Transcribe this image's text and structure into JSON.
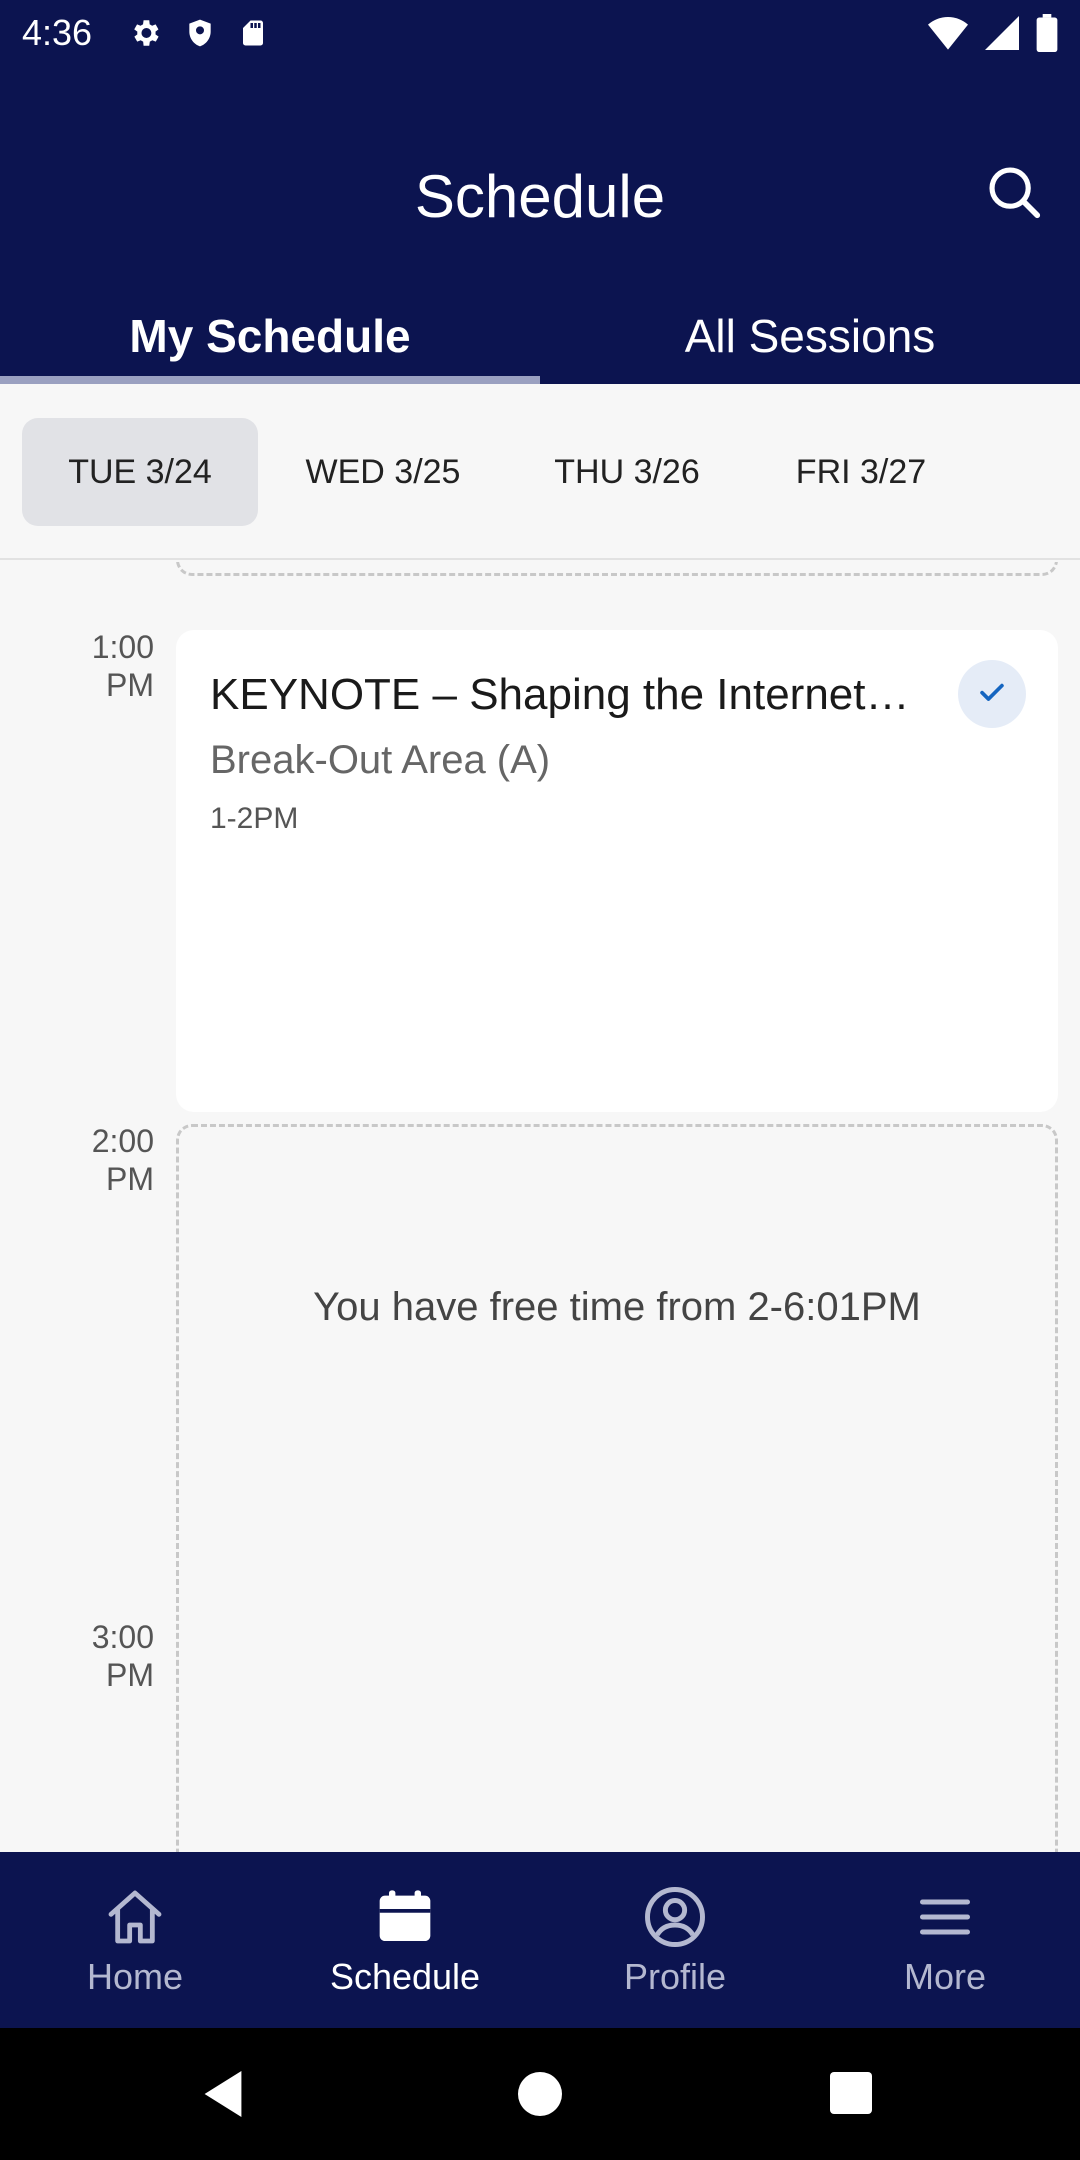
{
  "status_bar": {
    "time": "4:36",
    "icons_left": [
      "gear-icon",
      "shield-icon",
      "sd-card-icon"
    ],
    "icons_right": [
      "wifi-icon",
      "signal-icon",
      "battery-icon"
    ]
  },
  "app_bar": {
    "title": "Schedule",
    "search_icon": "search-icon"
  },
  "tabs": [
    {
      "label": "My Schedule",
      "active": true
    },
    {
      "label": "All Sessions",
      "active": false
    }
  ],
  "dates": [
    {
      "label": "TUE 3/24",
      "selected": true
    },
    {
      "label": "WED 3/25",
      "selected": false
    },
    {
      "label": "THU 3/26",
      "selected": false
    },
    {
      "label": "FRI 3/27",
      "selected": false
    }
  ],
  "time_labels": [
    {
      "hour": "1:00",
      "period": "PM"
    },
    {
      "hour": "2:00",
      "period": "PM"
    },
    {
      "hour": "3:00",
      "period": "PM"
    }
  ],
  "session": {
    "title": "KEYNOTE – Shaping the Internet…",
    "location": "Break-Out Area (A)",
    "time": "1-2PM",
    "added": true
  },
  "free_time": {
    "text": "You have free time from 2-6:01PM"
  },
  "bottom_nav": [
    {
      "label": "Home",
      "icon": "home-icon",
      "active": false
    },
    {
      "label": "Schedule",
      "icon": "calendar-icon",
      "active": true
    },
    {
      "label": "Profile",
      "icon": "profile-icon",
      "active": false
    },
    {
      "label": "More",
      "icon": "menu-icon",
      "active": false
    }
  ],
  "colors": {
    "primary": "#0c1450",
    "background": "#f7f7f7",
    "selected_chip": "#e1e2e6",
    "check": "#1565c0"
  }
}
